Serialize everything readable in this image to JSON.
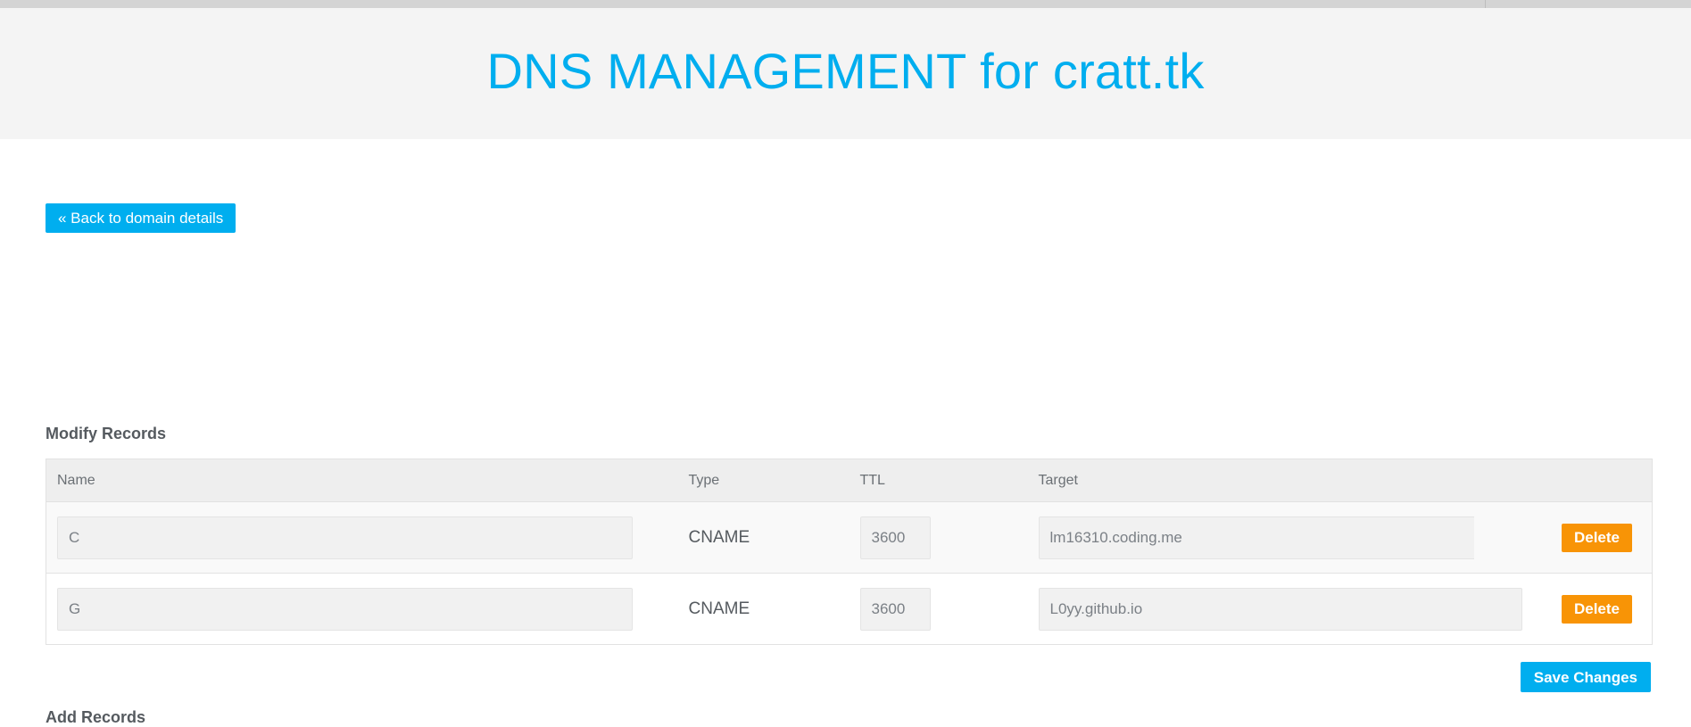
{
  "window": {
    "top_strip": ""
  },
  "header": {
    "title": "DNS MANAGEMENT for cratt.tk"
  },
  "nav": {
    "back_label": "« Back to domain details"
  },
  "sections": {
    "modify_records_title": "Modify Records",
    "add_records_title": "Add Records"
  },
  "table": {
    "columns": [
      "Name",
      "Type",
      "TTL",
      "Target",
      ""
    ],
    "rows": [
      {
        "name": "C",
        "type": "CNAME",
        "ttl": "3600",
        "target": "lm16310.coding.me",
        "delete_label": "Delete"
      },
      {
        "name": "G",
        "type": "CNAME",
        "ttl": "3600",
        "target": "L0yy.github.io",
        "delete_label": "Delete"
      }
    ]
  },
  "actions": {
    "save_label": "Save Changes"
  },
  "colors": {
    "accent": "#00aeef",
    "warning": "#f89406",
    "banner": "#f4f4f4",
    "table_header": "#eeeeee",
    "text": "#555a5f"
  }
}
